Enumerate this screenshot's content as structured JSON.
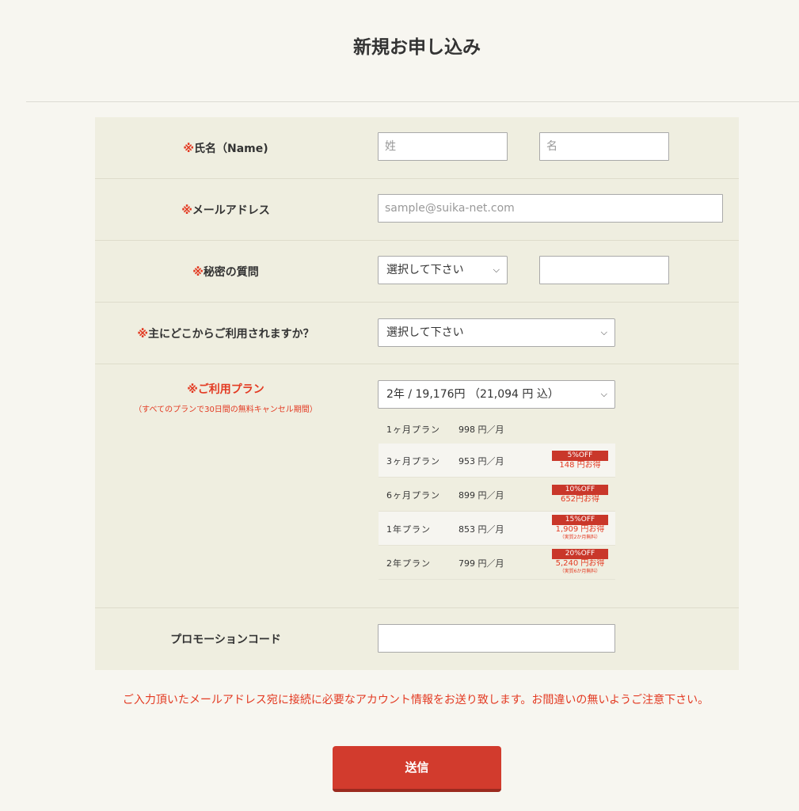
{
  "page_title": "新規お申し込み",
  "form": {
    "name": {
      "label_req": "※",
      "label": "氏名（Name)",
      "last_placeholder": "姓",
      "first_placeholder": "名"
    },
    "email": {
      "label_req": "※",
      "label": "メールアドレス",
      "placeholder": "sample@suika-net.com"
    },
    "secret": {
      "label_req": "※",
      "label": "秘密の質問",
      "select_value": "選択して下さい",
      "answer_value": ""
    },
    "usage": {
      "label_req": "※",
      "label": "主にどこからご利用されますか？",
      "select_value": "選択して下さい"
    },
    "plan": {
      "label_req": "※",
      "label": "ご利用プラン",
      "note": "（すべてのプランで30日間の無料キャンセル期間）",
      "select_value": "2年 / 19,176円 （21,094 円 込）",
      "rows": [
        {
          "name": "1ヶ月プラン",
          "price": "998 円／月",
          "off": "",
          "save": "",
          "note": ""
        },
        {
          "name": "3ヶ月プラン",
          "price": "953 円／月",
          "off": "5%OFF",
          "save": "148 円お得",
          "note": ""
        },
        {
          "name": "6ヶ月プラン",
          "price": "899 円／月",
          "off": "10%OFF",
          "save": "652円お得",
          "note": ""
        },
        {
          "name": "1年プラン",
          "price": "853 円／月",
          "off": "15%OFF",
          "save": "1,909 円お得",
          "note": "（実質2か月無料）"
        },
        {
          "name": "2年プラン",
          "price": "799 円／月",
          "off": "20%OFF",
          "save": "5,240 円お得",
          "note": "（実質6か月無料）"
        }
      ]
    },
    "promo": {
      "label": "プロモーションコード",
      "value": ""
    }
  },
  "notice": "ご入力頂いたメールアドレス宛に接続に必要なアカウント情報をお送り致します。お間違いの無いようご注意下さい。",
  "submit_label": "送信",
  "icons": {
    "select": "chevron-down-icon"
  },
  "colors": {
    "accent": "#e33a22",
    "button": "#d23b2d",
    "form_bg": "#efeee0",
    "page_bg": "#f7f6f0"
  }
}
